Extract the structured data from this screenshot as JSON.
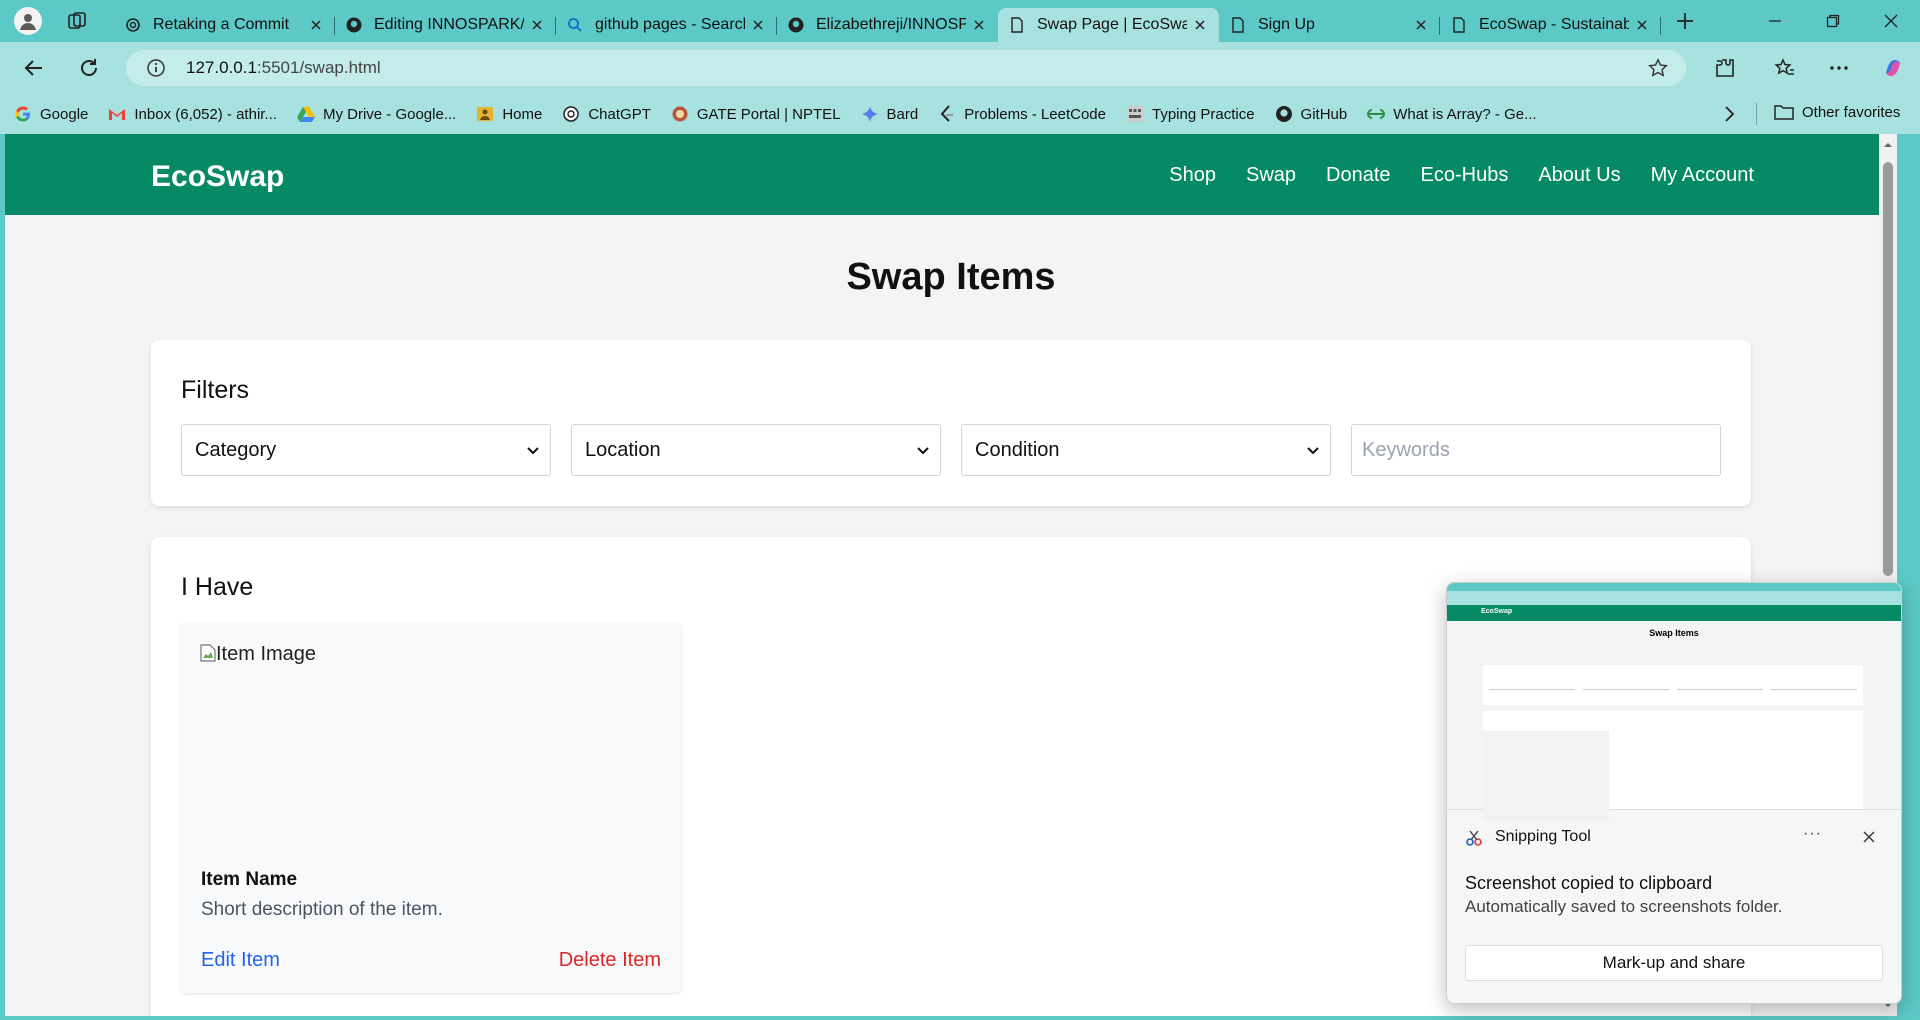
{
  "browser": {
    "tabs": [
      {
        "title": "Retaking a Commit",
        "icon": "chatgpt-icon"
      },
      {
        "title": "Editing INNOSPARK/R",
        "icon": "github-icon"
      },
      {
        "title": "github pages - Search",
        "icon": "search-icon"
      },
      {
        "title": "Elizabethreji/INNOSP",
        "icon": "github-icon"
      },
      {
        "title": "Swap Page | EcoSwap",
        "icon": "page-icon",
        "active": true
      },
      {
        "title": "Sign Up",
        "icon": "page-icon"
      },
      {
        "title": "EcoSwap - Sustainabl",
        "icon": "page-icon"
      }
    ],
    "url_host": "127.0.0.1",
    "url_rest": ":5501/swap.html",
    "bookmarks": [
      {
        "label": "Google",
        "icon": "google-icon"
      },
      {
        "label": "Inbox (6,052) - athir...",
        "icon": "gmail-icon"
      },
      {
        "label": "My Drive - Google...",
        "icon": "drive-icon"
      },
      {
        "label": "Home",
        "icon": "home-icon"
      },
      {
        "label": "ChatGPT",
        "icon": "chatgpt-icon"
      },
      {
        "label": "GATE Portal | NPTEL",
        "icon": "nptel-icon"
      },
      {
        "label": "Bard",
        "icon": "sparkle-icon"
      },
      {
        "label": "Problems - LeetCode",
        "icon": "leetcode-icon"
      },
      {
        "label": "Typing Practice",
        "icon": "typing-icon"
      },
      {
        "label": "GitHub",
        "icon": "github-icon"
      },
      {
        "label": "What is Array? - Ge...",
        "icon": "gfg-icon"
      }
    ],
    "other_favorites": "Other favorites"
  },
  "site": {
    "logo": "EcoSwap",
    "nav": [
      "Shop",
      "Swap",
      "Donate",
      "Eco-Hubs",
      "About Us",
      "My Account"
    ],
    "brand_color": "#058a65"
  },
  "page": {
    "title": "Swap Items",
    "filters": {
      "heading": "Filters",
      "category": "Category",
      "location": "Location",
      "condition": "Condition",
      "keywords_placeholder": "Keywords"
    },
    "i_have": {
      "heading": "I Have",
      "item": {
        "image_alt": "Item Image",
        "name": "Item Name",
        "description": "Short description of the item.",
        "edit_label": "Edit Item",
        "delete_label": "Delete Item"
      }
    }
  },
  "toast": {
    "app": "Snipping Tool",
    "more": "···",
    "message": "Screenshot copied to clipboard",
    "sub": "Automatically saved to screenshots folder.",
    "button": "Mark-up and share"
  }
}
